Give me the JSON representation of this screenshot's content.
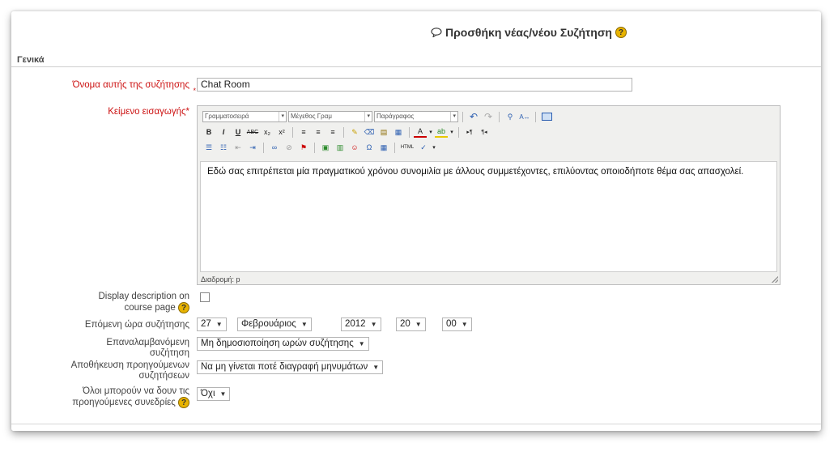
{
  "header": {
    "title": "Προσθήκη νέας/νέου Συζήτηση",
    "chat_icon": "speech-bubble-icon",
    "help_icon": "help-icon"
  },
  "section": {
    "legend": "Γενικά"
  },
  "fields": {
    "name": {
      "label": "Όνομα αυτής της συζήτησης",
      "value": "Chat Room"
    },
    "intro": {
      "label": "Κείμενο εισαγωγής",
      "required_mark": "*"
    },
    "display_description": {
      "label_line1": "Display description on",
      "label_line2": "course page",
      "checked": false
    },
    "next_time": {
      "label": "Επόμενη ώρα συζήτησης",
      "day": "27",
      "month": "Φεβρουάριος",
      "year": "2012",
      "hour": "20",
      "minute": "00"
    },
    "repeat": {
      "label_line1": "Επαναλαμβανόμενη",
      "label_line2": "συζήτηση",
      "value": "Μη δημοσιοποίηση ωρών συζήτησης"
    },
    "save_sessions": {
      "label_line1": "Αποθήκευση προηγούμενων",
      "label_line2": "συζητήσεων",
      "value": "Να μη γίνεται ποτέ διαγραφή μηνυμάτων"
    },
    "view_sessions": {
      "label_line1": "Όλοι μπορούν να δουν τις",
      "label_line2": "προηγούμενες συνεδρίες",
      "value": "Όχι"
    }
  },
  "editor": {
    "font_family": "Γραμματοσειρά",
    "font_size": "Μέγεθος Γραμ",
    "format": "Παράγραφος",
    "content": "Εδώ σας επιτρέπεται μία πραγματικού χρόνου συνομιλία με άλλους συμμετέχοντες, επιλύοντας οποιοδήποτε θέμα σας απασχολεί.",
    "path_label": "Διαδρομή: p",
    "toolbar_row2": [
      "B",
      "I",
      "U",
      "ABC",
      "x₂",
      "x²"
    ],
    "html_btn": "HTML"
  },
  "colors": {
    "required": "#cc1111",
    "help": "#e8b300"
  }
}
